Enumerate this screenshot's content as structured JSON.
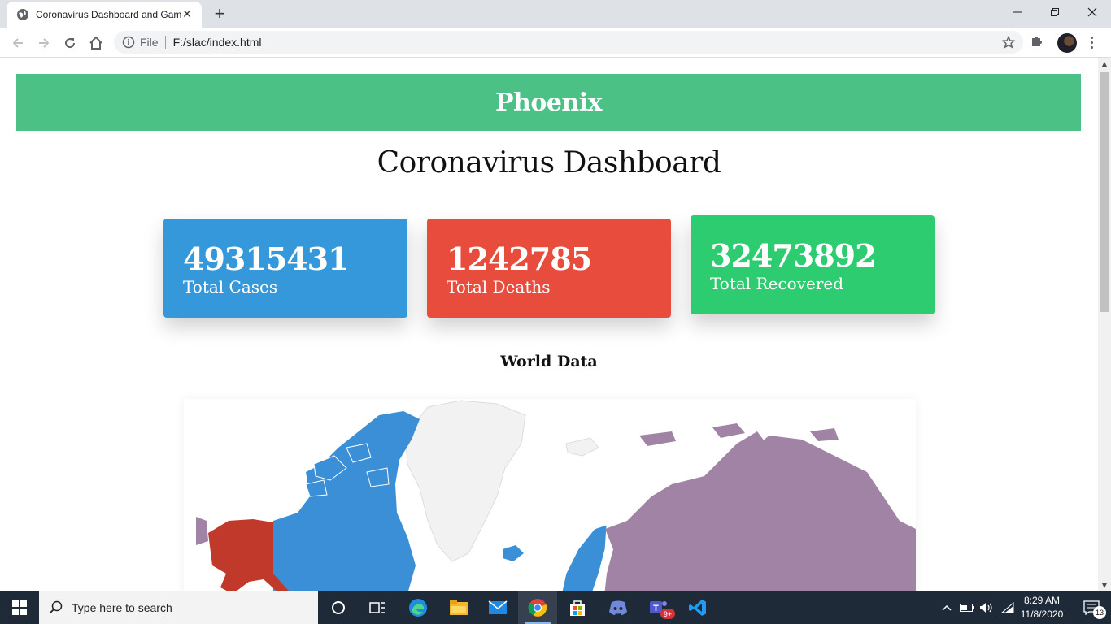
{
  "browser": {
    "tab_title": "Coronavirus Dashboard and Gam",
    "url_scheme": "File",
    "url": "F:/slac/index.html"
  },
  "page": {
    "brand": "Phoenix",
    "title": "Coronavirus Dashboard",
    "stats": {
      "cases": {
        "value": "49315431",
        "label": "Total Cases"
      },
      "deaths": {
        "value": "1242785",
        "label": "Total Deaths"
      },
      "recovered": {
        "value": "32473892",
        "label": "Total Recovered"
      }
    },
    "map_title": "World Data"
  },
  "colors": {
    "brand_green": "#4bc186",
    "cases_blue": "#3498db",
    "deaths_red": "#e74c3c",
    "recovered_green": "#2ecc71"
  },
  "taskbar": {
    "search_placeholder": "Type here to search",
    "time": "8:29 AM",
    "date": "11/8/2020",
    "teams_badge": "9+",
    "notifications": "13"
  }
}
